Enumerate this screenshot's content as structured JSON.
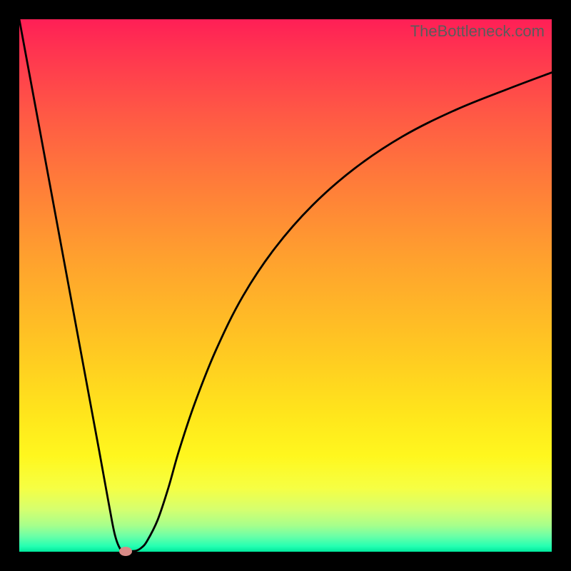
{
  "watermark_text": "TheBottleneck.com",
  "chart_data": {
    "type": "line",
    "title": "",
    "xlabel": "",
    "ylabel": "",
    "xlim": [
      0,
      100
    ],
    "ylim": [
      0,
      100
    ],
    "grid": false,
    "series": [
      {
        "name": "curve",
        "x": [
          0,
          5,
          10,
          15,
          17,
          18,
          19,
          20,
          21,
          22,
          23,
          24,
          26,
          28,
          30,
          33,
          37,
          42,
          48,
          55,
          63,
          72,
          82,
          92,
          100
        ],
        "y": [
          100,
          73,
          46,
          19,
          8,
          3,
          0.5,
          0.2,
          0.1,
          0.2,
          0.8,
          2,
          6,
          12,
          19,
          28,
          38,
          48,
          57,
          65,
          72,
          78,
          83,
          87,
          90
        ]
      }
    ],
    "marker": {
      "x": 20,
      "y": 0.2,
      "color": "#d98b87"
    },
    "background_gradient": {
      "type": "vertical",
      "stops": [
        {
          "pos": 0.0,
          "color": "#ff1f56"
        },
        {
          "pos": 0.18,
          "color": "#ff5945"
        },
        {
          "pos": 0.45,
          "color": "#ffa12e"
        },
        {
          "pos": 0.74,
          "color": "#ffe51c"
        },
        {
          "pos": 0.92,
          "color": "#d6ff6e"
        },
        {
          "pos": 1.0,
          "color": "#00e79b"
        }
      ]
    }
  }
}
